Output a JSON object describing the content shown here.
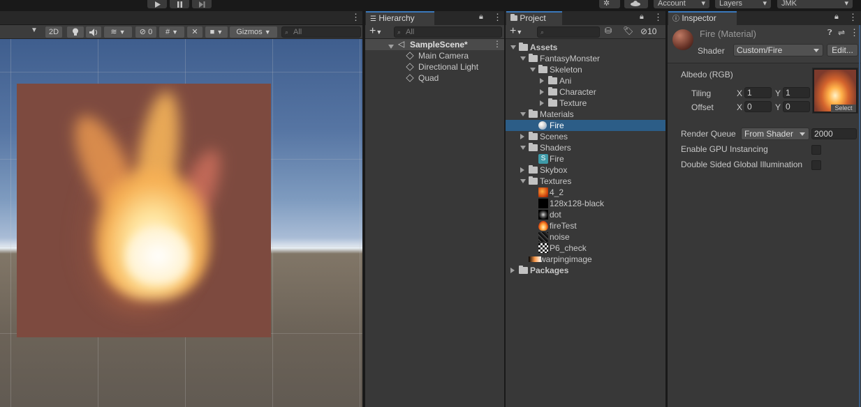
{
  "toolbar": {
    "account_label": "Account",
    "layers_label": "Layers",
    "layout_label": "JMK"
  },
  "scene": {
    "mode_2d": "2D",
    "hidden_count": "0",
    "gizmos_label": "Gizmos",
    "search_placeholder": "All"
  },
  "hierarchy": {
    "tab_label": "Hierarchy",
    "search_placeholder": "All",
    "scene_name": "SampleScene*",
    "objects": [
      "Main Camera",
      "Directional Light",
      "Quad"
    ]
  },
  "project": {
    "tab_label": "Project",
    "hidden_count": "10",
    "tree": [
      {
        "label": "Assets",
        "icon": "folder-icon",
        "fold": "open",
        "bold": true
      },
      {
        "label": "FantasyMonster",
        "icon": "folder-icon",
        "fold": "open"
      },
      {
        "label": "Skeleton",
        "icon": "folder-icon",
        "fold": "open"
      },
      {
        "label": "Ani",
        "icon": "folder-icon",
        "fold": "closed"
      },
      {
        "label": "Character",
        "icon": "folder-icon",
        "fold": "closed"
      },
      {
        "label": "Texture",
        "icon": "folder-icon",
        "fold": "closed"
      },
      {
        "label": "Materials",
        "icon": "folder-icon",
        "fold": "open"
      },
      {
        "label": "Fire",
        "icon": "material-sphere-icon",
        "fold": "none",
        "selected": true
      },
      {
        "label": "Scenes",
        "icon": "folder-icon",
        "fold": "closed"
      },
      {
        "label": "Shaders",
        "icon": "folder-icon",
        "fold": "open"
      },
      {
        "label": "Fire",
        "icon": "shader-icon",
        "fold": "none"
      },
      {
        "label": "Skybox",
        "icon": "folder-icon",
        "fold": "closed"
      },
      {
        "label": "Textures",
        "icon": "folder-icon",
        "fold": "open"
      },
      {
        "label": "4_2",
        "icon": "texture-orange-icon",
        "fold": "none"
      },
      {
        "label": "128x128-black",
        "icon": "texture-black-icon",
        "fold": "none"
      },
      {
        "label": "dot",
        "icon": "texture-dot-icon",
        "fold": "none"
      },
      {
        "label": "fireTest",
        "icon": "texture-flame-icon",
        "fold": "none"
      },
      {
        "label": "noise",
        "icon": "texture-noise-icon",
        "fold": "none"
      },
      {
        "label": "P6_check",
        "icon": "texture-check-icon",
        "fold": "none"
      },
      {
        "label": "warpingimage",
        "icon": "texture-gradient-icon",
        "fold": "none"
      },
      {
        "label": "Packages",
        "icon": "folder-icon",
        "fold": "closed",
        "bold": true
      }
    ]
  },
  "inspector": {
    "tab_label": "Inspector",
    "title": "Fire (Material)",
    "shader_label": "Shader",
    "shader_value": "Custom/Fire",
    "edit_label": "Edit...",
    "albedo_label": "Albedo (RGB)",
    "tiling_label": "Tiling",
    "offset_label": "Offset",
    "x_label": "X",
    "y_label": "Y",
    "tiling_x": "1",
    "tiling_y": "1",
    "offset_x": "0",
    "offset_y": "0",
    "select_label": "Select",
    "render_queue_label": "Render Queue",
    "render_queue_mode": "From Shader",
    "render_queue_value": "2000",
    "gpu_instancing_label": "Enable GPU Instancing",
    "gpu_instancing_checked": false,
    "double_sided_gi_label": "Double Sided Global Illumination",
    "double_sided_gi_checked": false
  }
}
